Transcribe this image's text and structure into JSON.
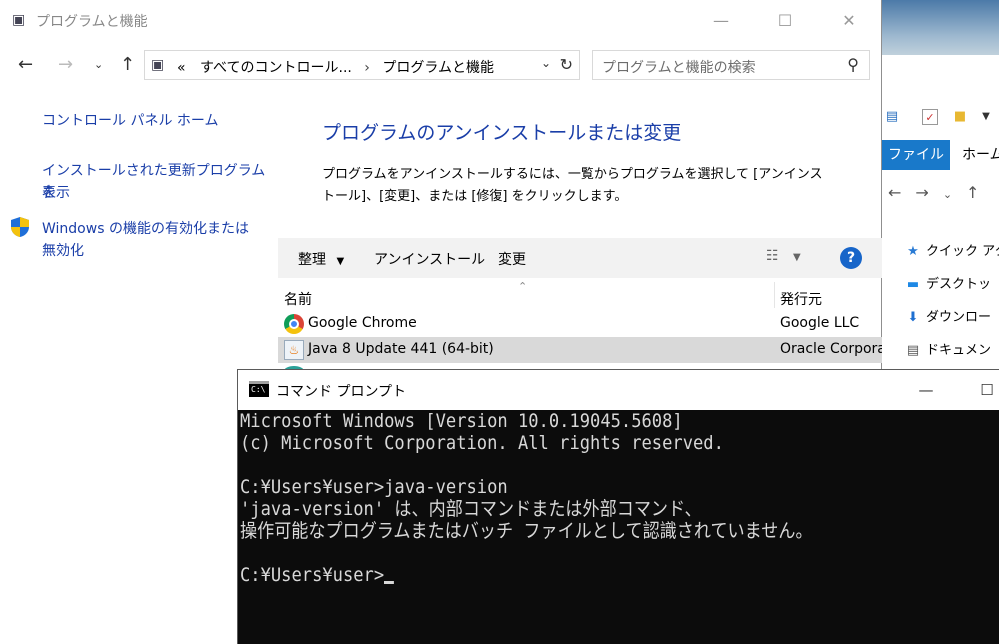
{
  "explorer": {
    "tab_file": "ファイル",
    "tab_home": "ホーム",
    "sidebar": [
      {
        "label": "クイック アク",
        "icon": "star-icon"
      },
      {
        "label": "デスクトッ",
        "icon": "desktop-icon"
      },
      {
        "label": "ダウンロー",
        "icon": "download-icon"
      },
      {
        "label": "ドキュメン",
        "icon": "document-icon"
      }
    ]
  },
  "control_panel": {
    "title": "プログラムと機能",
    "address": {
      "overflow": "«",
      "crumb1": "すべてのコントロール...",
      "crumb2": "プログラムと機能"
    },
    "search_placeholder": "プログラムと機能の検索",
    "left_nav": {
      "home": "コントロール パネル ホーム",
      "updates_line1": "インストールされた更新プログラムを",
      "updates_line2": "表示",
      "features_line1": "Windows の機能の有効化または",
      "features_line2": "無効化"
    },
    "main_title": "プログラムのアンインストールまたは変更",
    "main_desc_line1": "プログラムをアンインストールするには、一覧からプログラムを選択して [アンインス",
    "main_desc_line2": "トール]、[変更]、または [修復] をクリックします。",
    "toolbar": {
      "organize": "整理",
      "uninstall": "アンインストール",
      "change": "変更"
    },
    "columns": {
      "name": "名前",
      "publisher": "発行元"
    },
    "programs": [
      {
        "name": "Google Chrome",
        "publisher": "Google LLC"
      },
      {
        "name": "Java 8 Update 441 (64-bit)",
        "publisher": "Oracle Corporation"
      }
    ]
  },
  "cmd": {
    "title": "コマンド プロンプト",
    "lines": [
      "Microsoft Windows [Version 10.0.19045.5608]",
      "(c) Microsoft Corporation. All rights reserved.",
      "",
      "C:¥Users¥user>java-version",
      "'java-version' は、内部コマンドまたは外部コマンド、",
      "操作可能なプログラムまたはバッチ ファイルとして認識されていません。",
      "",
      "C:¥Users¥user>"
    ]
  }
}
